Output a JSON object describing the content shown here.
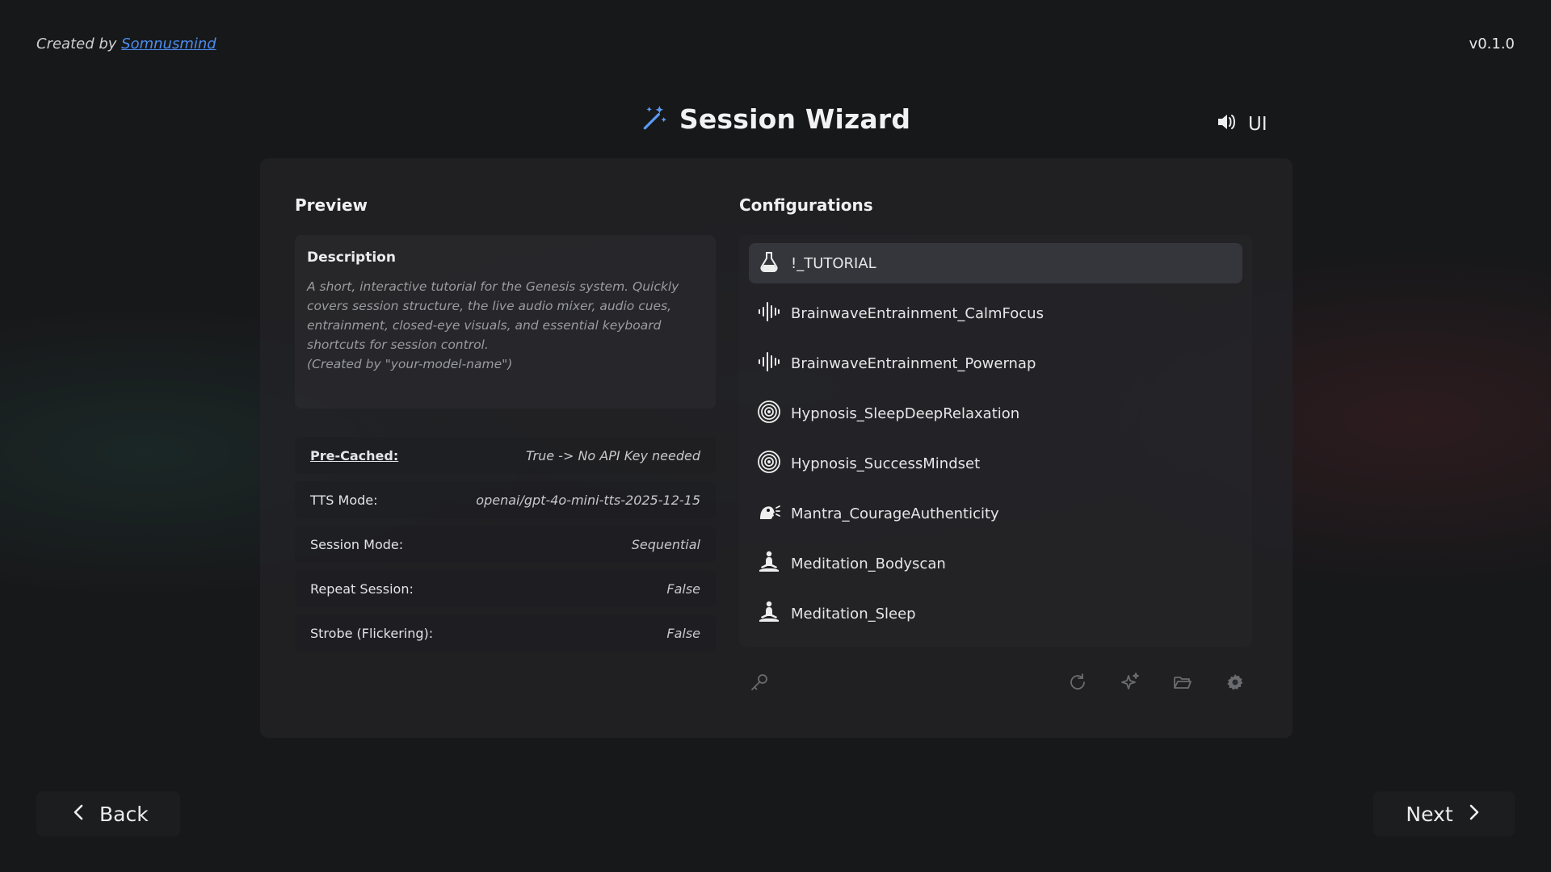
{
  "footer_credit": {
    "prefix": "Created by",
    "author": "Somnusmind"
  },
  "version": "v0.1.0",
  "header": {
    "title": "Session Wizard",
    "sound_label": "UI"
  },
  "preview": {
    "heading": "Preview",
    "description_title": "Description",
    "description_text": "A short, interactive tutorial for the Genesis system. Quickly\ncovers session structure, the live audio mixer, audio cues,\nentrainment, closed-eye visuals, and essential keyboard\nshortcuts for session control.\n(Created by \"your-model-name\")",
    "properties": [
      {
        "key": "Pre-Cached:",
        "value": "True -> No API Key needed"
      },
      {
        "key": "TTS Mode:",
        "value": "openai/gpt-4o-mini-tts-2025-12-15"
      },
      {
        "key": "Session Mode:",
        "value": "Sequential"
      },
      {
        "key": "Repeat Session:",
        "value": "False"
      },
      {
        "key": "Strobe (Flickering):",
        "value": "False"
      }
    ]
  },
  "configurations": {
    "heading": "Configurations",
    "items": [
      {
        "label": "!_TUTORIAL",
        "icon": "flask-icon"
      },
      {
        "label": "BrainwaveEntrainment_CalmFocus",
        "icon": "waveform-icon"
      },
      {
        "label": "BrainwaveEntrainment_Powernap",
        "icon": "waveform-icon"
      },
      {
        "label": "Hypnosis_SleepDeepRelaxation",
        "icon": "spiral-icon"
      },
      {
        "label": "Hypnosis_SuccessMindset",
        "icon": "spiral-icon"
      },
      {
        "label": "Mantra_CourageAuthenticity",
        "icon": "speaking-head-icon"
      },
      {
        "label": "Meditation_Bodyscan",
        "icon": "meditation-icon"
      },
      {
        "label": "Meditation_Sleep",
        "icon": "meditation-icon"
      }
    ]
  },
  "navigation": {
    "back_label": "Back",
    "next_label": "Next"
  },
  "colors": {
    "accent": "#4b8df0",
    "background": "#17181a"
  }
}
